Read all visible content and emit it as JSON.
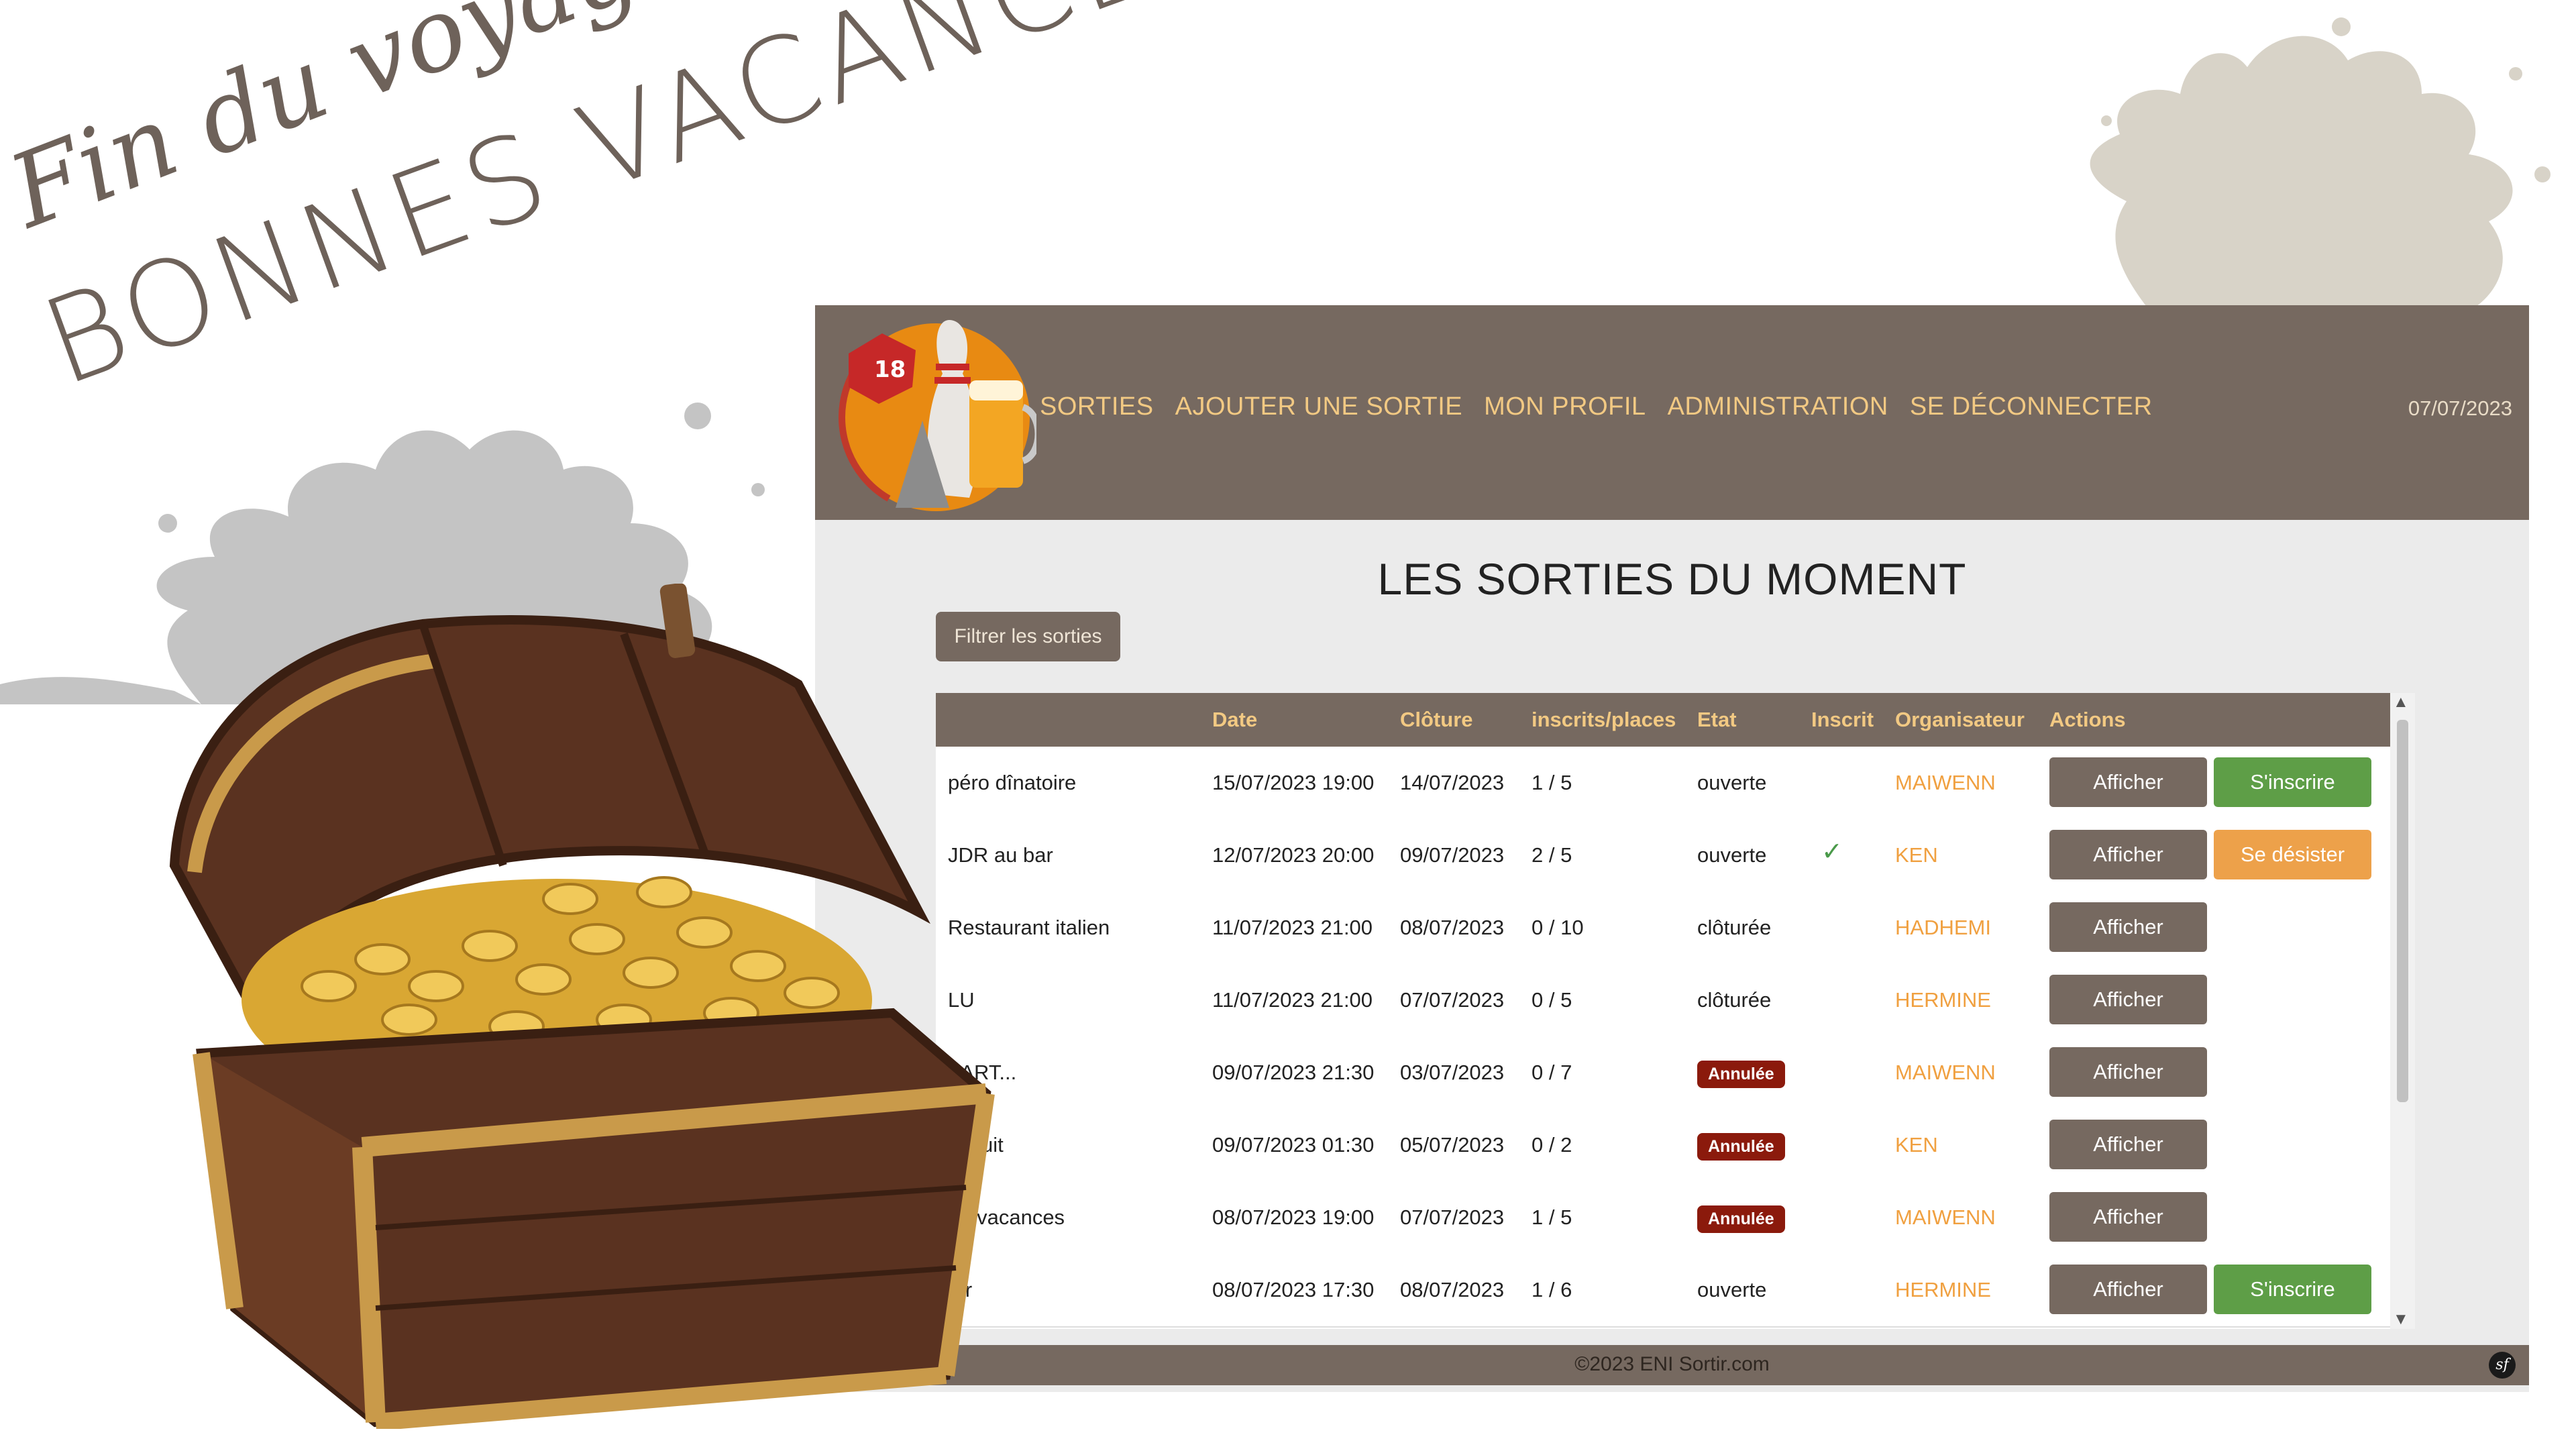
{
  "slide": {
    "heading_1": "Fin du voyage",
    "heading_2": "BONNES VACANCES"
  },
  "app": {
    "nav": {
      "items": [
        {
          "label": "SORTIES"
        },
        {
          "label": "AJOUTER UNE SORTIE"
        },
        {
          "label": "MON PROFIL"
        },
        {
          "label": "ADMINISTRATION"
        },
        {
          "label": "SE DÉCONNECTER"
        }
      ],
      "date": "07/07/2023"
    },
    "page_title": "LES SORTIES DU MOMENT",
    "filter_button": "Filtrer les sorties",
    "table": {
      "headers": {
        "date": "Date",
        "cloture": "Clôture",
        "places": "inscrits/places",
        "etat": "Etat",
        "inscrit": "Inscrit",
        "organisateur": "Organisateur",
        "actions": "Actions"
      },
      "rows": [
        {
          "name": "péro dînatoire",
          "date": "15/07/2023 19:00",
          "cloture": "14/07/2023",
          "places": "1 / 5",
          "etat": "ouverte",
          "badge": "",
          "inscrit": false,
          "organisateur": "MAIWENN",
          "show": "Afficher",
          "action": "S'inscrire",
          "action_type": "join"
        },
        {
          "name": "JDR au bar",
          "date": "12/07/2023 20:00",
          "cloture": "09/07/2023",
          "places": "2 / 5",
          "etat": "ouverte",
          "badge": "",
          "inscrit": true,
          "organisateur": "KEN",
          "show": "Afficher",
          "action": "Se désister",
          "action_type": "leave"
        },
        {
          "name": "Restaurant italien",
          "date": "11/07/2023 21:00",
          "cloture": "08/07/2023",
          "places": "0 / 10",
          "etat": "clôturée",
          "badge": "",
          "inscrit": false,
          "organisateur": "HADHEMI",
          "show": "Afficher",
          "action": "",
          "action_type": ""
        },
        {
          "name": "LU",
          "date": "11/07/2023 21:00",
          "cloture": "07/07/2023",
          "places": "0 / 5",
          "etat": "clôturée",
          "badge": "",
          "inscrit": false,
          "organisateur": "HERMINE",
          "show": "Afficher",
          "action": "",
          "action_type": ""
        },
        {
          "name": "PART...",
          "date": "09/07/2023 21:30",
          "cloture": "03/07/2023",
          "places": "0 / 7",
          "etat": "",
          "badge": "Annulée",
          "inscrit": false,
          "organisateur": "MAIWENN",
          "show": "Afficher",
          "action": "",
          "action_type": ""
        },
        {
          "name": "minuit",
          "date": "09/07/2023 01:30",
          "cloture": "05/07/2023",
          "places": "0 / 2",
          "etat": "",
          "badge": "Annulée",
          "inscrit": false,
          "organisateur": "KEN",
          "show": "Afficher",
          "action": "",
          "action_type": ""
        },
        {
          "name": "de vacances",
          "date": "08/07/2023 19:00",
          "cloture": "07/07/2023",
          "places": "1 / 5",
          "etat": "",
          "badge": "Annulée",
          "inscrit": false,
          "organisateur": "MAIWENN",
          "show": "Afficher",
          "action": "",
          "action_type": ""
        },
        {
          "name": "ter",
          "date": "08/07/2023 17:30",
          "cloture": "08/07/2023",
          "places": "1 / 6",
          "etat": "ouverte",
          "badge": "",
          "inscrit": false,
          "organisateur": "HERMINE",
          "show": "Afficher",
          "action": "S'inscrire",
          "action_type": "join"
        }
      ]
    },
    "footer": "©2023 ENI Sortir.com",
    "footer_icon": "sf"
  },
  "colors": {
    "nav_bg": "#766960",
    "nav_text": "#f2c983",
    "join": "#5e9e47",
    "leave": "#eda14a",
    "cancelled": "#8b1a0c"
  },
  "icons": [
    "logo-dice-bowling-beer",
    "check-icon",
    "symfony-icon",
    "scroll-up-icon",
    "scroll-down-icon",
    "treasure-chest-image",
    "paint-splash"
  ]
}
